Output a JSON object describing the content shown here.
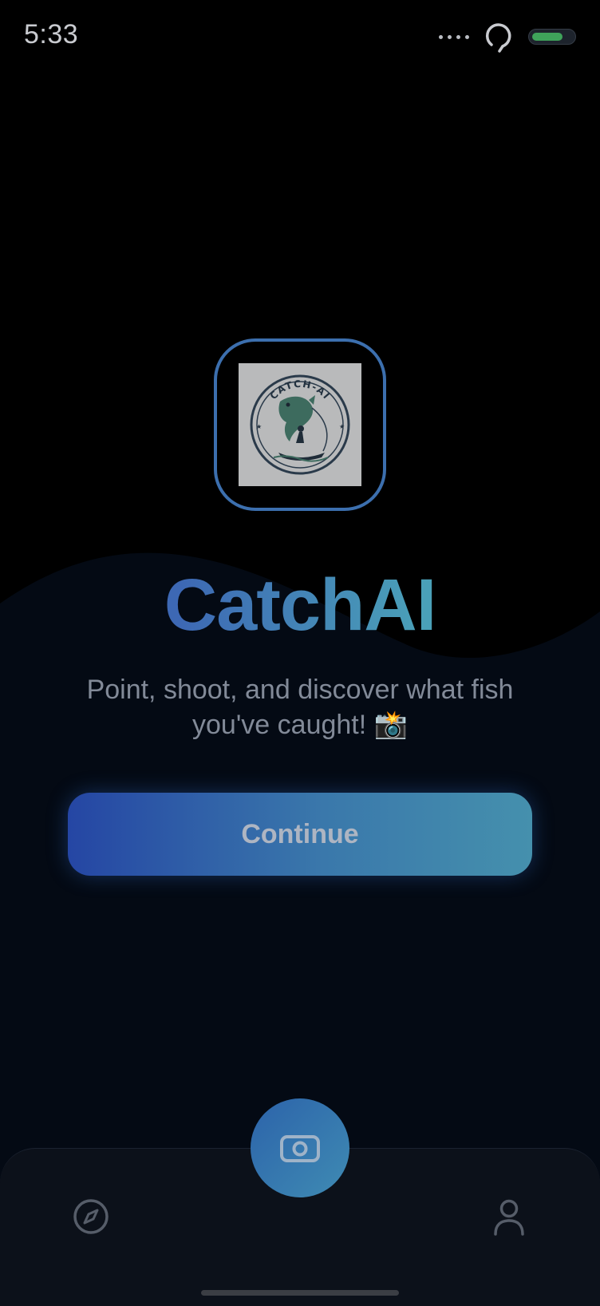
{
  "status_bar": {
    "time": "5:33",
    "icons": [
      "more-dots-icon",
      "loading-icon",
      "battery-icon"
    ],
    "battery_level": 0.75
  },
  "logo": {
    "icon": "catchai-logo-image",
    "text": "CATCH-AI"
  },
  "app_title": "CatchAI",
  "tagline": "Point, shoot, and discover what fish you've caught! 📸",
  "continue_button": {
    "label": "Continue"
  },
  "tab_bar": {
    "left_icon": "compass-icon",
    "center_icon": "camera-icon",
    "right_icon": "user-icon"
  },
  "colors": {
    "background": "#000000",
    "wave": "#040a14",
    "accent_blue": "#2546a4",
    "accent_teal": "#4590ad",
    "logo_border": "#3c6fae",
    "tab_bar": "#0c111a",
    "muted_text": "#828a98"
  }
}
